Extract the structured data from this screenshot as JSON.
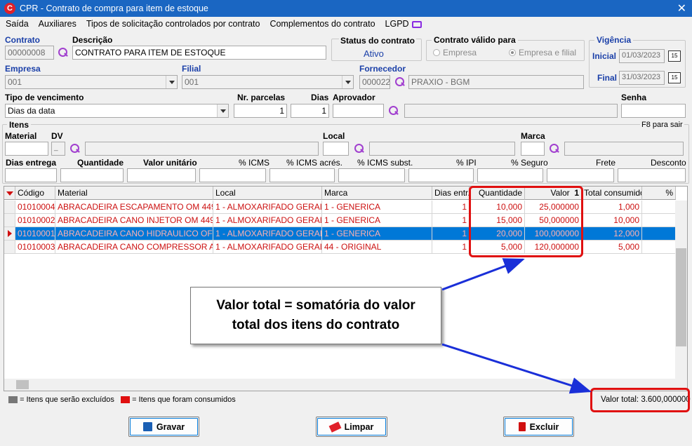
{
  "window": {
    "title": "CPR - Contrato de compra para item de estoque",
    "close_glyph": "✕"
  },
  "menu": [
    "Saída",
    "Auxiliares",
    "Tipos de solicitação controlados por contrato",
    "Complementos do contrato",
    "LGPD"
  ],
  "contrato": {
    "label": "Contrato",
    "value": "00000008"
  },
  "descricao": {
    "label": "Descrição",
    "value": "CONTRATO PARA ITEM DE ESTOQUE"
  },
  "status": {
    "label": "Status do contrato",
    "value": "Ativo"
  },
  "valido_para": {
    "label": "Contrato válido para",
    "opt1": "Empresa",
    "opt2": "Empresa e filial"
  },
  "vigencia": {
    "label": "Vigência",
    "inicial_label": "Inicial",
    "inicial": "01/03/2023",
    "final_label": "Final",
    "final": "31/03/2023",
    "cal_icon": "15"
  },
  "empresa": {
    "label": "Empresa",
    "value": "001"
  },
  "filial": {
    "label": "Filial",
    "value": "001"
  },
  "fornecedor": {
    "label": "Fornecedor",
    "code": "000022",
    "name": "PRAXIO - BGM"
  },
  "vencimento": {
    "label": "Tipo de vencimento",
    "value": "Dias da data"
  },
  "parcelas": {
    "label": "Nr. parcelas",
    "value": "1"
  },
  "dias": {
    "label": "Dias",
    "value": "1"
  },
  "aprovador": {
    "label": "Aprovador",
    "value": ""
  },
  "senha": {
    "label": "Senha",
    "value": ""
  },
  "itens": {
    "label": "Itens",
    "f8": "F8 para sair",
    "material": "Material",
    "dv": "DV",
    "dv_value": "_",
    "local": "Local",
    "marca": "Marca",
    "dias_entrega": "Dias entrega",
    "quantidade": "Quantidade",
    "valor_unitario": "Valor unitário",
    "icms": "% ICMS",
    "icms_acres": "% ICMS acrés.",
    "icms_subst": "% ICMS subst.",
    "ipi": "% IPI",
    "seguro": "% Seguro",
    "frete": "Frete",
    "desconto": "Desconto"
  },
  "grid": {
    "headers": [
      "Código",
      "Material",
      "Local",
      "Marca",
      "Dias entr.",
      "Quantidade",
      "Valor",
      "Total consumido",
      "%"
    ],
    "sort_indicator": "1",
    "rows": [
      [
        "01010004",
        "ABRACADEIRA ESCAPAMENTO OM 449 6...",
        "1 - ALMOXARIFADO GERAL ...",
        "1 - GENERICA",
        "1",
        "10,000",
        "25,000000",
        "1,000"
      ],
      [
        "01010002",
        "ABRACADEIRA CANO INJETOR OM 449 4...",
        "1 - ALMOXARIFADO GERAL ...",
        "1 - GENERICA",
        "1",
        "15,000",
        "50,000000",
        "10,000"
      ],
      [
        "01010001",
        "ABRACADEIRA CANO HIDRAULICO OF 14...",
        "1 - ALMOXARIFADO GERAL ...",
        "1 - GENERICA",
        "1",
        "20,000",
        "100,000000",
        "12,000"
      ],
      [
        "01010003",
        "ABRACADEIRA CANO COMPRESSOR AR ...",
        "1 - ALMOXARIFADO GERAL ...",
        "44 - ORIGINAL",
        "1",
        "5,000",
        "120,000000",
        "5,000"
      ]
    ]
  },
  "legend": {
    "excluded": "= Itens que serão excluídos",
    "consumed": "= Itens que foram consumidos",
    "total": "Valor total: 3.600,000000"
  },
  "callout": {
    "line1": "Valor total = somatória do valor",
    "line2": "total dos itens do contrato"
  },
  "buttons": {
    "save": "Gravar",
    "clear": "Limpar",
    "delete": "Excluir"
  }
}
